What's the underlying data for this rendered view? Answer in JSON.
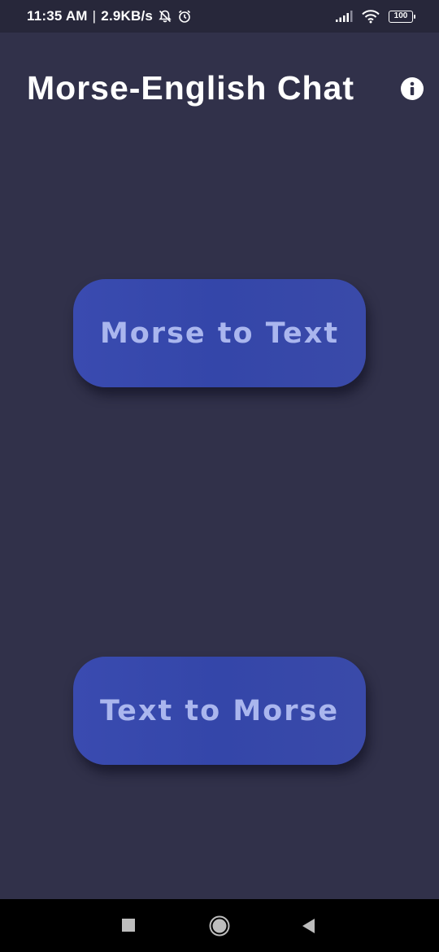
{
  "status_bar": {
    "time": "11:35 AM",
    "separator": "|",
    "network_speed": "2.9KB/s",
    "battery_level": "100",
    "icons": [
      "bell-off-icon",
      "alarm-icon",
      "signal-icon",
      "wifi-icon",
      "battery-icon"
    ]
  },
  "header": {
    "title": "Morse-English Chat",
    "info_icon": "info-icon"
  },
  "main": {
    "morse_to_text_label": "Morse to Text",
    "text_to_morse_label": "Text to Morse"
  },
  "nav_bar": {
    "icons": [
      "recents-icon",
      "home-icon",
      "back-icon"
    ]
  },
  "colors": {
    "background": "#31314a",
    "status_bar": "#27273a",
    "button": "#3a4bb0",
    "button_text": "#aab6ee",
    "title_text": "#ffffff"
  }
}
